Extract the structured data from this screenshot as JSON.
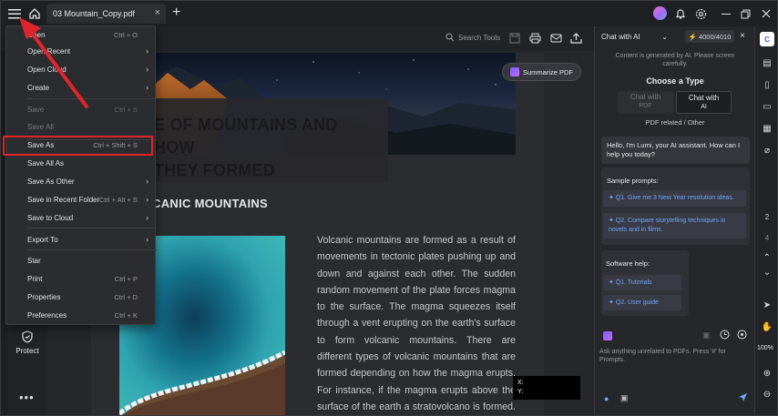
{
  "titlebar": {
    "tab_title": "03 Mountain_Copy.pdf",
    "tab_close": "×",
    "new_tab": "+"
  },
  "toolbar": {
    "search_label": "Search Tools",
    "summarize_label": "Summarize PDF"
  },
  "menu": {
    "items": [
      {
        "label": "Open",
        "shortcut": "Ctrl + O",
        "arrow": "",
        "disabled": false
      },
      {
        "label": "Open Recent",
        "shortcut": "",
        "arrow": "›",
        "disabled": false
      },
      {
        "label": "Open Cloud",
        "shortcut": "",
        "arrow": "›",
        "disabled": false
      },
      {
        "label": "Create",
        "shortcut": "",
        "arrow": "›",
        "disabled": false
      },
      {
        "label": "Save",
        "shortcut": "Ctrl + S",
        "arrow": "",
        "disabled": true
      },
      {
        "label": "Save All",
        "shortcut": "",
        "arrow": "",
        "disabled": true
      },
      {
        "label": "Save As",
        "shortcut": "Ctrl + Shift + S",
        "arrow": "",
        "disabled": false
      },
      {
        "label": "Save All As",
        "shortcut": "",
        "arrow": "",
        "disabled": false
      },
      {
        "label": "Save As Other",
        "shortcut": "",
        "arrow": "›",
        "disabled": false
      },
      {
        "label": "Save in Recent Folder",
        "shortcut": "Ctrl + Alt + S",
        "arrow": "›",
        "disabled": false
      },
      {
        "label": "Save to Cloud",
        "shortcut": "",
        "arrow": "›",
        "disabled": false
      },
      {
        "label": "Export To",
        "shortcut": "",
        "arrow": "›",
        "disabled": false
      },
      {
        "label": "Star",
        "shortcut": "",
        "arrow": "",
        "disabled": false
      },
      {
        "label": "Print",
        "shortcut": "Ctrl + P",
        "arrow": "",
        "disabled": false
      },
      {
        "label": "Properties",
        "shortcut": "Ctrl + D",
        "arrow": "",
        "disabled": false
      },
      {
        "label": "Preferences",
        "shortcut": "Ctrl + K",
        "arrow": "",
        "disabled": false
      }
    ]
  },
  "leftrail": {
    "protect_label": "Protect",
    "more_label": "•••"
  },
  "document": {
    "heading_line1": "E OF MOUNTAINS AND HOW",
    "heading_line2": "THEY FORMED",
    "section_title": "CANIC MOUNTAINS",
    "paragraph": "Volcanic mountains are formed as a result of movements in tectonic plates pushing up and down and against each other. The sudden random movement of the plate forces magma to the surface. The magma squeezes itself through a vent erupting on the earth's surface to form volcanic mountains. There are different types of volcanic mountains that are formed depending on how the magma erupts. For instance, if the magma erupts above the surface of the earth a stratovolcano is formed. Examples of such mountains include",
    "coord_x": "X:",
    "coord_y": "Y:"
  },
  "ai_panel": {
    "mode_select": "Chat with AI",
    "token_count": "4000/4010",
    "disclaimer": "Content is generated by AI. Please screen carefully.",
    "choose_type": "Choose a Type",
    "option1_line1": "Chat with",
    "option1_line2": "PDF",
    "option2_line1": "Chat with",
    "option2_line2": "AI",
    "pdf_related": "PDF related / Other",
    "greeting": "Hello, I'm Lumi, your AI assistant. How can I help you today?",
    "sample_prompts_title": "Sample prompts:",
    "prompt1": "Q1. Give me 3 New Year resolution ideas.",
    "prompt2": "Q2. Compare storytelling techniques in novels and in films.",
    "software_help_title": "Software help:",
    "help1": "Q1. Tutorials",
    "help2": "Q2. User guide",
    "input_placeholder": "Ask anything unrelated to PDFs. Press '#' for Prompts."
  },
  "rightrail": {
    "page_current": "2",
    "page_next": "4",
    "zoom": "100%"
  },
  "colors": {
    "highlight": "#e0242b",
    "accent_blue": "#6ea8ff",
    "ai_purple": "#7b5cff"
  }
}
